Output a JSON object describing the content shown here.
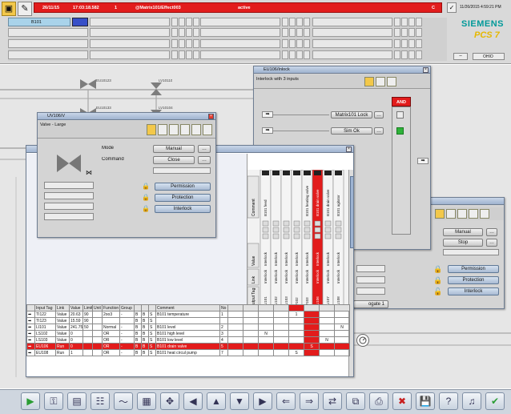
{
  "header": {
    "date": "26/11/15",
    "time": "17:03:18.582",
    "count": "1",
    "tag": "@Matrix101/Effect003",
    "state": "active",
    "flag": "C",
    "clock": "11/26/2015 4:59:21 PM",
    "area_label": "B101",
    "brand_name": "SIEMENS",
    "brand_product": "PCS 7",
    "overview_label": "OHIO"
  },
  "plant": {
    "valve_tags": [
      "EU10123",
      "LV10110",
      "EU10133",
      "LV10104"
    ]
  },
  "interlock_window": {
    "title": "EU106/Inlock",
    "subtitle": "Interlock with 3 inputs",
    "state_label": "AND",
    "input1_label": "Matrix101 Lock",
    "input2_label": "Sim Ok"
  },
  "valve_window": {
    "title": "UV106/V",
    "type_label": "Valve - Large",
    "mode_label": "Mode",
    "command_label": "Command",
    "mode_value": "Manual",
    "command_value": "Close",
    "permission_label": "Permission",
    "protection_label": "Protection",
    "interlock_label": "Interlock"
  },
  "right_faceplate": {
    "mode_value": "Manual",
    "command_value": "Stop",
    "permission_label": "Permission",
    "protection_label": "Protection",
    "interlock_label": "Interlock",
    "aggregate_label": "ogate 1"
  },
  "matrix": {
    "row_header_comment": "Comment",
    "row_header_value": "Value",
    "row_header_link": "Link",
    "row_header_output": "Output Tag",
    "columns": [
      {
        "comment": "B101 feed",
        "value": "Interlock",
        "link": "Interlock",
        "tag": "EU101",
        "highlight": false
      },
      {
        "comment": "",
        "value": "Interlock",
        "link": "Interlock",
        "tag": "EU102",
        "highlight": false
      },
      {
        "comment": "",
        "value": "Interlock",
        "link": "Interlock",
        "tag": "EU103",
        "highlight": false
      },
      {
        "comment": "",
        "value": "Interlock",
        "link": "Interlock",
        "tag": "LV102",
        "highlight": false
      },
      {
        "comment": "B101 heating valve",
        "value": "Interlock",
        "link": "Interlock",
        "tag": "LV103",
        "highlight": false
      },
      {
        "comment": "B101 drain valve",
        "value": "Interlock",
        "link": "Interlock",
        "tag": "EU106",
        "highlight": true
      },
      {
        "comment": "B101 drain valve",
        "value": "Interlock",
        "link": "Interlock",
        "tag": "EU107",
        "highlight": false
      },
      {
        "comment": "B101 agitator",
        "value": "Interlock",
        "link": "Interlock",
        "tag": "EU108",
        "highlight": false
      }
    ],
    "input_headers": [
      "Input Tag",
      "Link",
      "Value",
      "Limit",
      "Unit",
      "Function",
      "Group",
      "Comment",
      "No"
    ],
    "input_rows": [
      {
        "tag": "TI122",
        "link": "Value",
        "value": "20.63",
        "limit": "90",
        "unit": "",
        "function": "2oo3",
        "group": "-",
        "comment": "B101 temperature",
        "no": "1",
        "marks": [
          "",
          "",
          "",
          "",
          "1",
          "",
          "",
          ""
        ],
        "highlight": false
      },
      {
        "tag": "TI123",
        "link": "Value",
        "value": "15.59",
        "limit": "90",
        "unit": "",
        "function": "",
        "group": "",
        "comment": "",
        "no": "",
        "marks": [
          "",
          "",
          "",
          "",
          "",
          "",
          "",
          ""
        ],
        "highlight": false
      },
      {
        "tag": "LI101",
        "link": "Value",
        "value": "241.75",
        "limit": "50",
        "unit": "",
        "function": "Normal",
        "group": "-",
        "comment": "B101 level",
        "no": "2",
        "marks": [
          "",
          "",
          "",
          "",
          "",
          "",
          "",
          "N"
        ],
        "highlight": false
      },
      {
        "tag": "LS102",
        "link": "Value",
        "value": "0",
        "limit": "",
        "unit": "",
        "function": "OR",
        "group": "-",
        "comment": "B101 high level",
        "no": "3",
        "marks": [
          "",
          "",
          "N",
          "",
          "",
          "",
          "",
          ""
        ],
        "highlight": false
      },
      {
        "tag": "LS103",
        "link": "Value",
        "value": "0",
        "limit": "",
        "unit": "",
        "function": "OR",
        "group": "-",
        "comment": "B101 low level",
        "no": "4",
        "marks": [
          "",
          "",
          "",
          "",
          "",
          "",
          "N",
          ""
        ],
        "highlight": false
      },
      {
        "tag": "EU106",
        "link": "Run",
        "value": "0",
        "limit": "",
        "unit": "",
        "function": "OR",
        "group": "-",
        "comment": "B101 drain valve",
        "no": "5",
        "marks": [
          "",
          "",
          "",
          "",
          "",
          "S",
          "",
          ""
        ],
        "highlight": true
      },
      {
        "tag": "EU108",
        "link": "Run",
        "value": "1",
        "limit": "",
        "unit": "",
        "function": "OR",
        "group": "-",
        "comment": "B101 heat circul pump",
        "no": "7",
        "marks": [
          "",
          "",
          "",
          "",
          "S",
          "",
          "",
          ""
        ],
        "highlight": false
      }
    ]
  },
  "toolbar": {
    "icons": [
      "play-icon",
      "key-icon",
      "folder-icon",
      "tree-icon",
      "trend-icon",
      "report-icon",
      "move-icon",
      "arrow-left-icon",
      "arrow-up-icon",
      "arrow-down-icon",
      "arrow-right-icon",
      "nav-back-icon",
      "nav-fwd-icon",
      "swap-icon",
      "copy-icon",
      "print-icon",
      "delete-icon",
      "save-icon",
      "help-icon",
      "speaker-icon",
      "ack-icon"
    ]
  },
  "colors": {
    "alarm_red": "#e21c1c",
    "header_grey": "#cfcfcf",
    "active_green": "#2fb23a",
    "siemens_teal": "#009999",
    "pcs7_yellow": "#e6b800"
  }
}
